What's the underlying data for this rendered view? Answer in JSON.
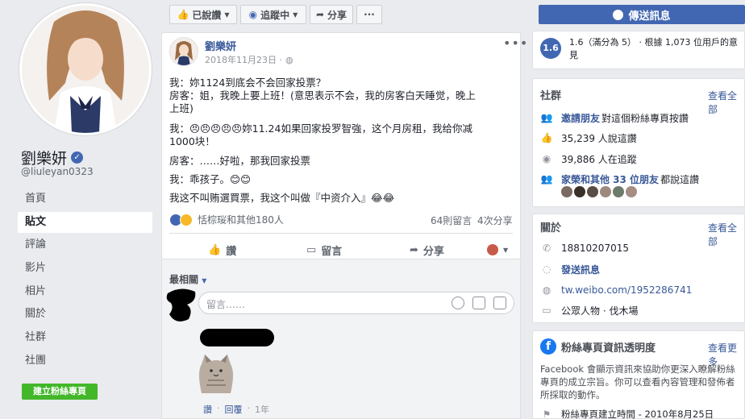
{
  "profile": {
    "name": "劉樂妍",
    "username": "@liuleyan0323"
  },
  "nav": {
    "items": [
      "首頁",
      "貼文",
      "評論",
      "影片",
      "相片",
      "關於",
      "社群",
      "社團"
    ],
    "create_page": "建立粉絲專頁"
  },
  "top_actions": {
    "like": "已說讚",
    "follow": "追蹤中",
    "share": "分享",
    "more": "···"
  },
  "post": {
    "author": "劉樂妍",
    "date": "2018年11月23日 ·",
    "lines": [
      "我：妳1124到底会不会回家投票？",
      "房客：姐，我晚上要上班！(意思表示不会，我的房客白天睡觉，晚上",
      "上班)",
      "我：😠😠😠😠😠妳11.24如果回家投罗智強，这个月房租，我给你减",
      "1000块！",
      "房客：……好啦，那我回家投票",
      "我：乖孩子。😊😊",
      "我这不叫贿選買票，我这个叫做『中资介入』😂😂"
    ],
    "reactions_text": "恬棕珱和其他180人",
    "comment_count": "64則留言",
    "share_count": "4次分享",
    "actions": {
      "like": "讚",
      "comment": "留言",
      "share": "分享"
    }
  },
  "comments": {
    "sort_label": "最相關",
    "input_placeholder": "留言……",
    "meta": {
      "like": "讚",
      "reply": "回覆",
      "time": "1年"
    }
  },
  "sidebar": {
    "send_message": "傳送訊息",
    "rating": {
      "score": "1.6",
      "text": "1.6（滿分為 5） · 根據 1,073 位用戶的意見"
    },
    "community": {
      "title": "社群",
      "see_all": "查看全部",
      "invite_link": "邀請朋友",
      "invite_text": "對這個粉絲專頁按讚",
      "likes": "35,239 人說這讚",
      "follows": "39,886 人在追蹤",
      "friends_link": "家榮和其他 33 位朋友",
      "friends_text": "都說這讚"
    },
    "about": {
      "title": "關於",
      "see_all": "查看全部",
      "phone": "18810207015",
      "send_message": "發送訊息",
      "website": "tw.weibo.com/1952286741",
      "category": "公眾人物 · 伐木場"
    },
    "transparency": {
      "title": "粉絲專頁資訊透明度",
      "see_more": "查看更多",
      "desc": "Facebook 會顯示資訊來協助你更深入瞭解粉絲專頁的成立宗旨。你可以查看內容管理和發佈者所採取的動作。",
      "created": "粉絲專頁建立時間 - 2010年8月25日"
    }
  },
  "colors": {
    "brand": "#4267b2",
    "link": "#385898",
    "green": "#42b72a",
    "background": "#e9ebee"
  }
}
